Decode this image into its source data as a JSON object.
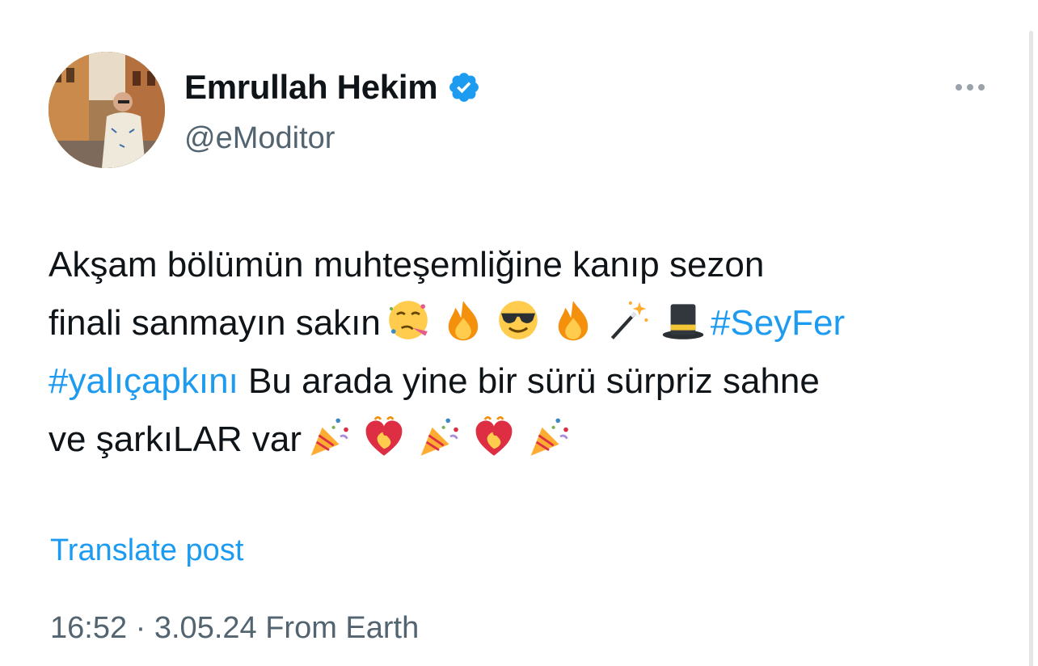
{
  "author": {
    "display_name": "Emrullah Hekim",
    "handle": "@eModitor",
    "verified": true
  },
  "tweet": {
    "line1": "Akşam bölümün muhteşemliğine kanıp sezon",
    "line2_text": "finali sanmayın sakın",
    "hashtag1": "#SeyFer",
    "hashtag2": "#yalıçapkını",
    "line3_text": " Bu arada yine bir sürü sürpriz sahne",
    "line4_text": "ve şarkıLAR var",
    "emojis_line2": [
      "partying-face",
      "fire",
      "smiling-face-with-sunglasses",
      "fire",
      "magic-wand",
      "top-hat"
    ],
    "emojis_line4": [
      "party-popper",
      "heart-on-fire",
      "party-popper",
      "heart-on-fire",
      "party-popper"
    ]
  },
  "actions": {
    "translate_label": "Translate post",
    "more_icon": "more-horizontal-icon"
  },
  "meta": {
    "timestamp": "16:52 · 3.05.24 From Earth"
  },
  "colors": {
    "link": "#1d9bf0",
    "secondary_text": "#536471",
    "primary_text": "#0f1419"
  }
}
